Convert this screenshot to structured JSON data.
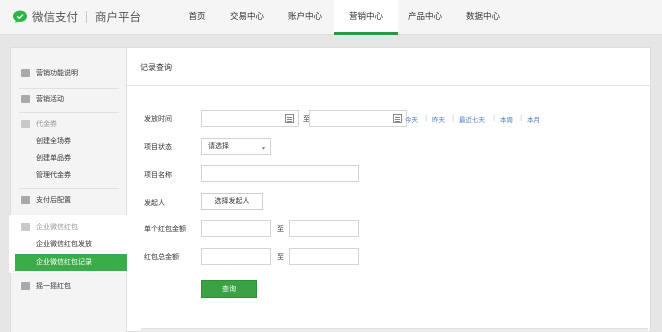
{
  "header": {
    "brand_name": "微信支付",
    "platform_name": "商户平台",
    "nav": [
      {
        "label": "首页",
        "active": false
      },
      {
        "label": "交易中心",
        "active": false
      },
      {
        "label": "账户中心",
        "active": false
      },
      {
        "label": "营销中心",
        "active": true
      },
      {
        "label": "产品中心",
        "active": false
      },
      {
        "label": "数据中心",
        "active": false
      }
    ],
    "accent_color": "#2a9a42"
  },
  "sidebar": {
    "items": [
      {
        "label": "营销功能说明",
        "icon": "book-icon"
      },
      {
        "label": "营销活动",
        "icon": "gift-icon"
      },
      {
        "label": "代金券",
        "icon": "coupon-icon"
      },
      {
        "label": "支付后配置",
        "icon": "document-icon"
      },
      {
        "label": "企业微信红包",
        "icon": "red-packet-icon"
      },
      {
        "label": "摇一摇红包",
        "icon": "shake-icon"
      }
    ],
    "coupon_subitems": [
      "创建全场券",
      "创建单品券",
      "管理代金券"
    ],
    "redpacket_subitems": [
      "企业微信红包发放",
      "企业微信红包记录"
    ],
    "active_subitem": "企业微信红包记录"
  },
  "content": {
    "title": "记录查询",
    "form": {
      "send_time_label": "发放时间",
      "to_label": "至",
      "quick_ranges": [
        "今天",
        "昨天",
        "最近七天",
        "本周",
        "本月"
      ],
      "status_label": "项目状态",
      "status_value": "请选择",
      "project_name_label": "项目名称",
      "sender_label": "发起人",
      "sender_button": "选择发起人",
      "single_amount_label": "单个红包金额",
      "total_amount_label": "红包总金额",
      "query_button": "查询"
    }
  }
}
